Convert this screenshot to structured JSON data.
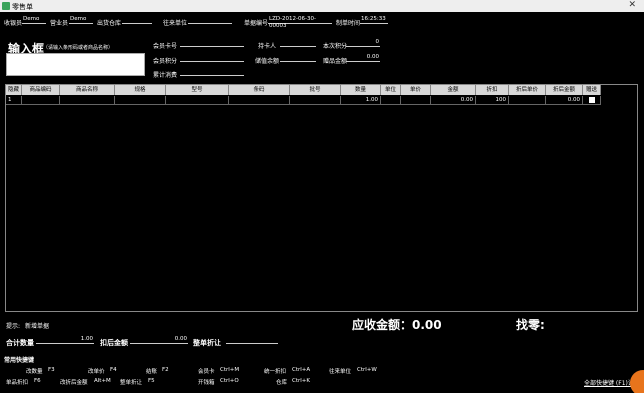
{
  "window": {
    "title": "零售单"
  },
  "header": {
    "cashier_label": "收银员",
    "cashier_value": "Demo",
    "salesperson_label": "营业员",
    "salesperson_value": "Demo",
    "warehouse_label": "出货仓库",
    "partner_label": "往来单位",
    "doc_no_label": "单据编号",
    "doc_no_value": "LZD-2012-06-30-00003",
    "time_label": "制单时间",
    "time_value": "16:25:33"
  },
  "input": {
    "title": "输入框",
    "hint": "（请输入条形码或者商品名称）"
  },
  "member": {
    "card_label": "会员卡号",
    "holder_label": "持卡人",
    "this_points_label": "本次积分",
    "this_points_value": "0",
    "points_label": "会员积分",
    "balance_label": "储值余额",
    "gift_amount_label": "赠品金额",
    "gift_amount_value": "0.00",
    "total_spent_label": "累计消费"
  },
  "table": {
    "columns": [
      "隐藏",
      "商品编码",
      "商品名称",
      "规格",
      "型号",
      "条码",
      "批号",
      "数量",
      "单位",
      "单价",
      "金额",
      "折扣",
      "折后单价",
      "折后金额",
      "赠送"
    ],
    "rows": [
      [
        "1",
        "",
        "",
        "",
        "",
        "",
        "",
        "1.00",
        "",
        "",
        "0.00",
        "100",
        "",
        "0.00",
        ""
      ]
    ]
  },
  "footer": {
    "tip_label": "提示:",
    "tip_value": "新增单据",
    "receivable_label": "应收金额：0.00",
    "change_label": "找零:",
    "total_qty_label": "合计数量",
    "total_qty_value": "1.00",
    "after_discount_label": "扣后金额",
    "after_discount_value": "0.00",
    "whole_discount_label": "整单折让"
  },
  "shortcuts": {
    "title": "常用快捷键",
    "items": [
      [
        "改数量",
        "F3"
      ],
      [
        "改单价",
        "F4"
      ],
      [
        "结账",
        "F2"
      ],
      [
        "会员卡",
        "Ctrl+M"
      ],
      [
        "统一折扣",
        "Ctrl+A"
      ],
      [
        "往来单位",
        "Ctrl+W"
      ],
      [
        "单品折扣",
        "F6"
      ],
      [
        "改折后金额",
        "Alt+M"
      ],
      [
        "整单折让",
        "F5"
      ],
      [
        "开钱箱",
        "Ctrl+O"
      ],
      [
        "仓库",
        "Ctrl+K"
      ]
    ],
    "link": "全部快捷键 (F1)设置"
  }
}
